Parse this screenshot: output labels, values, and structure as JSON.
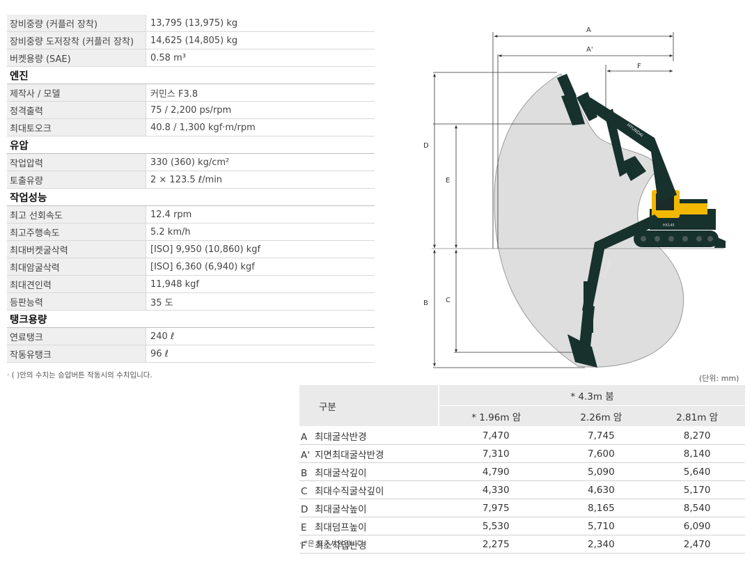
{
  "specs": [
    {
      "type": "row",
      "label": "장비중량 (커플러 장착)",
      "value": "13,795 (13,975) kg"
    },
    {
      "type": "row",
      "label": "장비중량 도저장착 (커플러 장착)",
      "value": "14,625 (14,805) kg"
    },
    {
      "type": "row",
      "label": "버켓용량 (SAE)",
      "value": "0.58 m³"
    },
    {
      "type": "section",
      "label": "엔진"
    },
    {
      "type": "row",
      "label": "제작사 / 모델",
      "value": "커민스 F3.8"
    },
    {
      "type": "row",
      "label": "정격출력",
      "value": "75 / 2,200 ps/rpm"
    },
    {
      "type": "row",
      "label": "최대토오크",
      "value": "40.8 / 1,300 kgf·m/rpm"
    },
    {
      "type": "section",
      "label": "유압"
    },
    {
      "type": "row",
      "label": "작업압력",
      "value": "330 (360) kg/cm²"
    },
    {
      "type": "row",
      "label": "토출유량",
      "value": "2 × 123.5 ℓ/min"
    },
    {
      "type": "section",
      "label": "작업성능"
    },
    {
      "type": "row",
      "label": "최고 선회속도",
      "value": "12.4 rpm"
    },
    {
      "type": "row",
      "label": "최고주행속도",
      "value": "5.2 km/h"
    },
    {
      "type": "row",
      "label": "최대버켓굴삭력",
      "value": "[ISO] 9,950 (10,860) kgf"
    },
    {
      "type": "row",
      "label": "최대암굴삭력",
      "value": "[ISO] 6,360 (6,940) kgf"
    },
    {
      "type": "row",
      "label": "최대견인력",
      "value": "11,948 kgf"
    },
    {
      "type": "row",
      "label": "등판능력",
      "value": "35 도"
    },
    {
      "type": "section",
      "label": "탱크용량"
    },
    {
      "type": "row",
      "label": "연료탱크",
      "value": "240 ℓ"
    },
    {
      "type": "row",
      "label": "작동유탱크",
      "value": "96 ℓ"
    }
  ],
  "spec_note": "· (      )안의 수치는 승압버튼 작동시의 수치입니다.",
  "unit": "(단위: mm)",
  "dims_table": {
    "header_label": "구분",
    "boom": "* 4.3m 붐",
    "arms": [
      "* 1.96m 암",
      "2.26m 암",
      "2.81m 암"
    ],
    "rows": [
      {
        "code": "A",
        "label": "최대굴삭반경",
        "values": [
          "7,470",
          "7,745",
          "8,270"
        ]
      },
      {
        "code": "A'",
        "label": "지면최대굴삭반경",
        "values": [
          "7,310",
          "7,600",
          "8,140"
        ]
      },
      {
        "code": "B",
        "label": "최대굴삭깊이",
        "values": [
          "4,790",
          "5,090",
          "5,640"
        ]
      },
      {
        "code": "C",
        "label": "최대수직굴삭깊이",
        "values": [
          "4,330",
          "4,630",
          "5,170"
        ]
      },
      {
        "code": "D",
        "label": "최대굴삭높이",
        "values": [
          "7,975",
          "8,165",
          "8,540"
        ]
      },
      {
        "code": "E",
        "label": "최대덤프높이",
        "values": [
          "5,530",
          "5,710",
          "6,090"
        ]
      },
      {
        "code": "F",
        "label": "최소작업반경",
        "values": [
          "2,275",
          "2,340",
          "2,470"
        ]
      }
    ]
  },
  "dims_note": "· *은 표준사양입니다.",
  "diagram": {
    "labels": {
      "A": "A",
      "A2": "A'",
      "F": "F",
      "D": "D",
      "E": "E",
      "B": "B",
      "C": "C"
    },
    "brand": "HYUNDAI",
    "colors": {
      "envelope": "#dedede",
      "machine": "#17312c",
      "cab": "#f2b800"
    }
  }
}
